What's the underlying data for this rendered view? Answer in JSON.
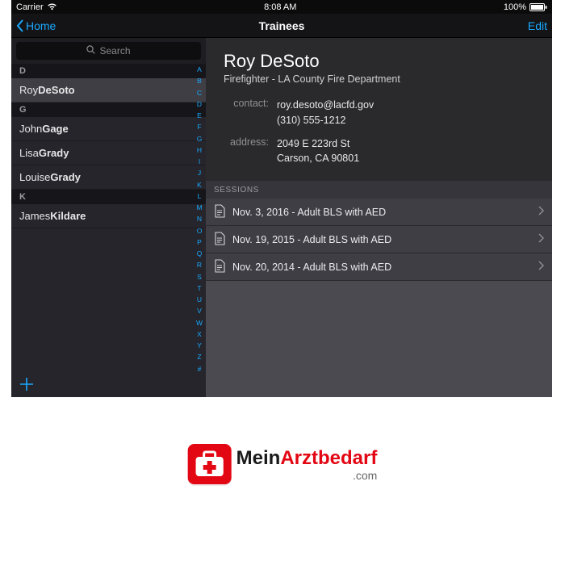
{
  "statusbar": {
    "carrier": "Carrier",
    "time": "8:08 AM",
    "battery": "100%"
  },
  "nav": {
    "back": "Home",
    "title": "Trainees",
    "edit": "Edit"
  },
  "search": {
    "placeholder": "Search"
  },
  "index_letters": [
    "A",
    "B",
    "C",
    "D",
    "E",
    "F",
    "G",
    "H",
    "I",
    "J",
    "K",
    "L",
    "M",
    "N",
    "O",
    "P",
    "Q",
    "R",
    "S",
    "T",
    "U",
    "V",
    "W",
    "X",
    "Y",
    "Z",
    "#"
  ],
  "list": {
    "sections": [
      {
        "letter": "D",
        "rows": [
          {
            "first": "Roy",
            "last": "DeSoto",
            "selected": true
          }
        ]
      },
      {
        "letter": "G",
        "rows": [
          {
            "first": "John",
            "last": "Gage"
          },
          {
            "first": "Lisa",
            "last": "Grady"
          },
          {
            "first": "Louise",
            "last": "Grady"
          }
        ]
      },
      {
        "letter": "K",
        "rows": [
          {
            "first": "James",
            "last": "Kildare"
          }
        ]
      }
    ]
  },
  "detail": {
    "name": "Roy DeSoto",
    "role": "Firefighter - LA County Fire Department",
    "labels": {
      "contact": "contact:",
      "address": "address:"
    },
    "contact_email": "roy.desoto@lacfd.gov",
    "contact_phone": "(310) 555-1212",
    "address_line1": "2049 E 223rd St",
    "address_line2": "Carson, CA 90801",
    "sessions_header": "SESSIONS",
    "sessions": [
      {
        "label": "Nov. 3, 2016 - Adult BLS with AED"
      },
      {
        "label": "Nov. 19, 2015 - Adult BLS with AED"
      },
      {
        "label": "Nov. 20, 2014 - Adult BLS with AED"
      }
    ]
  },
  "brand": {
    "name_black": "Mein",
    "name_red": "Arztbedarf",
    "tld": ".com"
  },
  "colors": {
    "accent": "#1AA9FF",
    "brand_red": "#E30613"
  }
}
